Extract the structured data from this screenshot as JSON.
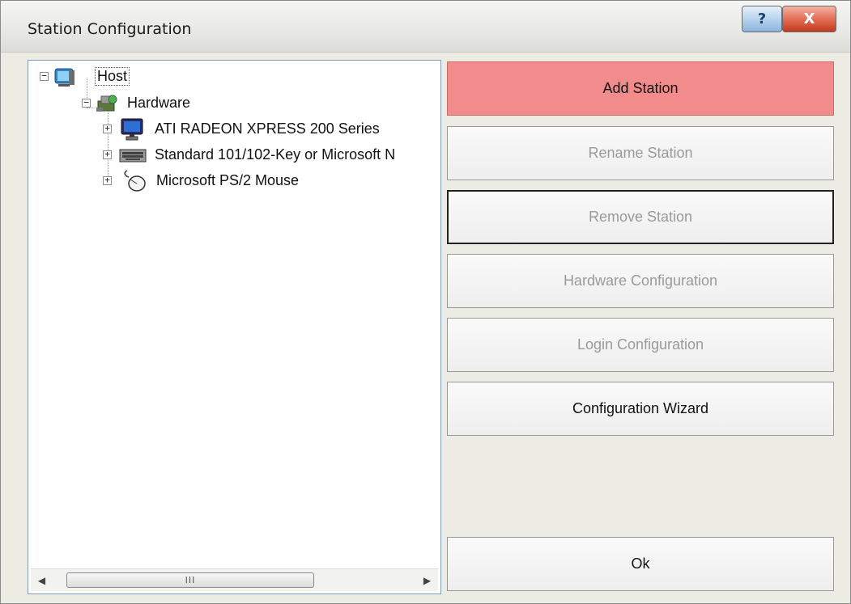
{
  "window": {
    "title": "Station Configuration",
    "help_glyph": "?",
    "close_glyph": "X"
  },
  "tree": {
    "root": {
      "label": "Host",
      "expander": "−",
      "icon": "host-monitor-icon"
    },
    "hardware": {
      "label": "Hardware",
      "expander": "−",
      "icon": "hardware-icon"
    },
    "children": [
      {
        "label": "ATI RADEON XPRESS 200 Series",
        "expander": "+",
        "icon": "display-monitor-icon"
      },
      {
        "label": "Standard 101/102-Key or Microsoft N",
        "expander": "+",
        "icon": "keyboard-icon"
      },
      {
        "label": "Microsoft PS/2 Mouse",
        "expander": "+",
        "icon": "mouse-icon"
      }
    ],
    "scroll": {
      "left_arrow": "◀",
      "right_arrow": "▶",
      "thumb_grip": "III"
    }
  },
  "buttons": {
    "add_station": "Add Station",
    "rename_station": "Rename Station",
    "remove_station": "Remove Station",
    "hardware_configuration": "Hardware Configuration",
    "login_configuration": "Login Configuration",
    "configuration_wizard": "Configuration Wizard",
    "ok": "Ok"
  },
  "colors": {
    "add_station_bg": "#f28b8b",
    "disabled_text": "#9a9a9a",
    "close_button": "#d24a2e"
  }
}
